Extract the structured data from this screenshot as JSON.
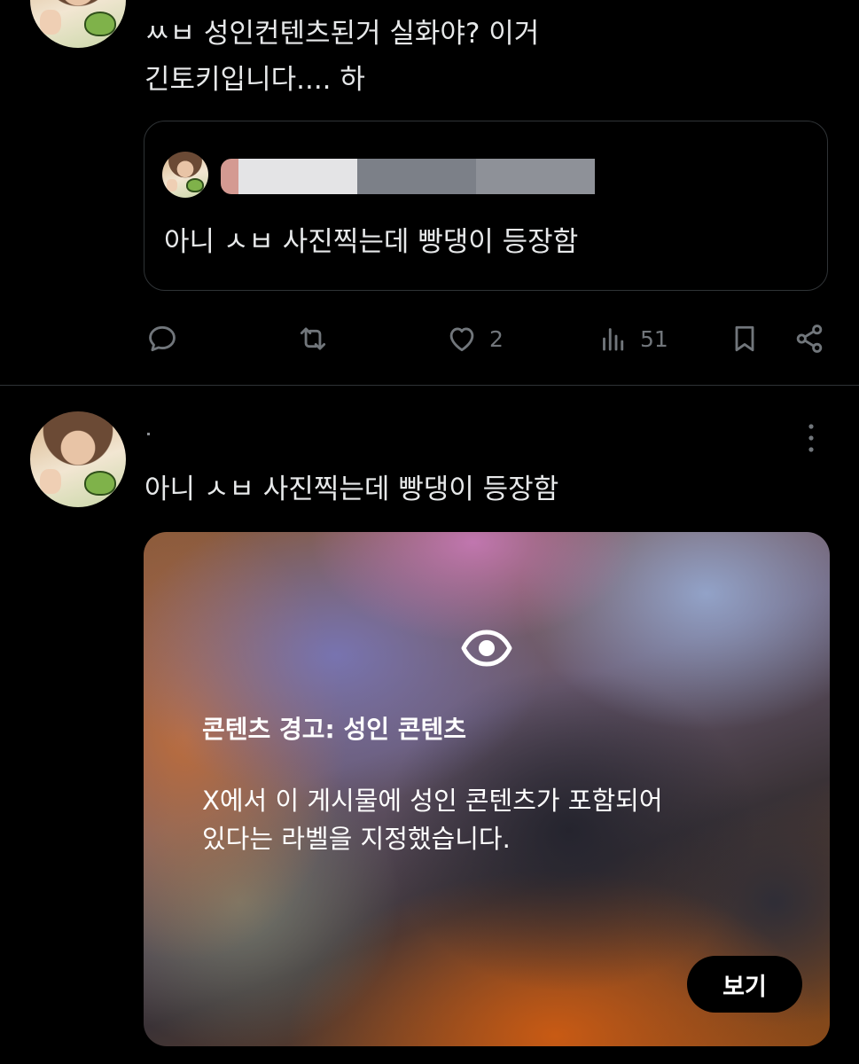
{
  "tweet_1": {
    "text": "ㅆㅂ 성인컨텐츠된거 실화야? 이거\n긴토키입니다.... 하",
    "quote": {
      "text": "아니 ㅅㅂ 사진찍는데 빵댕이 등장함"
    },
    "actions": {
      "reply_count": "",
      "retweet_count": "",
      "like_count": "2",
      "view_count": "51"
    }
  },
  "tweet_2": {
    "text": "아니 ㅅㅂ 사진찍는데 빵댕이 등장함",
    "media_warning": {
      "title": "콘텐츠 경고: 성인 콘텐츠",
      "body": "X에서 이 게시물에 성인 콘텐츠가 포함되어\n있다는 라벨을 지정했습니다.",
      "view_label": "보기"
    }
  },
  "icons": [
    "reply-icon",
    "retweet-icon",
    "heart-icon",
    "views-icon",
    "bookmark-icon",
    "share-icon",
    "more-icon",
    "eye-icon"
  ],
  "colors": {
    "background": "#000000",
    "text": "#e7e9ea",
    "muted": "#71767b",
    "border": "#2f3336"
  }
}
